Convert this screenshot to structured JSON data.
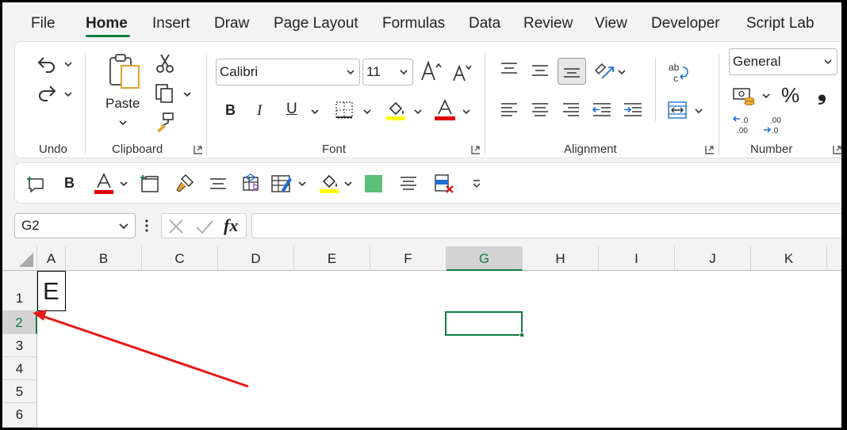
{
  "tabs": [
    "File",
    "Home",
    "Insert",
    "Draw",
    "Page Layout",
    "Formulas",
    "Data",
    "Review",
    "View",
    "Developer",
    "Script Lab"
  ],
  "active_tab": "Home",
  "ribbon": {
    "undo_group": "Undo",
    "clipboard_group": "Clipboard",
    "paste_label": "Paste",
    "font_group": "Font",
    "font_name": "Calibri",
    "font_size": "11",
    "alignment_group": "Alignment",
    "number_group": "Number",
    "number_format": "General",
    "percent_symbol": "%",
    "comma_symbol": "❟"
  },
  "formula_bar": {
    "name_box": "G2",
    "fx_label": "fx",
    "formula": ""
  },
  "grid": {
    "columns": [
      "A",
      "B",
      "C",
      "D",
      "E",
      "F",
      "G",
      "H",
      "I",
      "J",
      "K"
    ],
    "rows": [
      "1",
      "2",
      "3",
      "4",
      "5",
      "6"
    ],
    "selected_column": "G",
    "selected_row": "2",
    "cell_a1": "E"
  },
  "colors": {
    "accent": "#107c41",
    "highlight_yellow": "#ffff00",
    "font_red": "#e00000",
    "arrow_red": "#e81818",
    "fill_green": "#5cbf7a"
  }
}
